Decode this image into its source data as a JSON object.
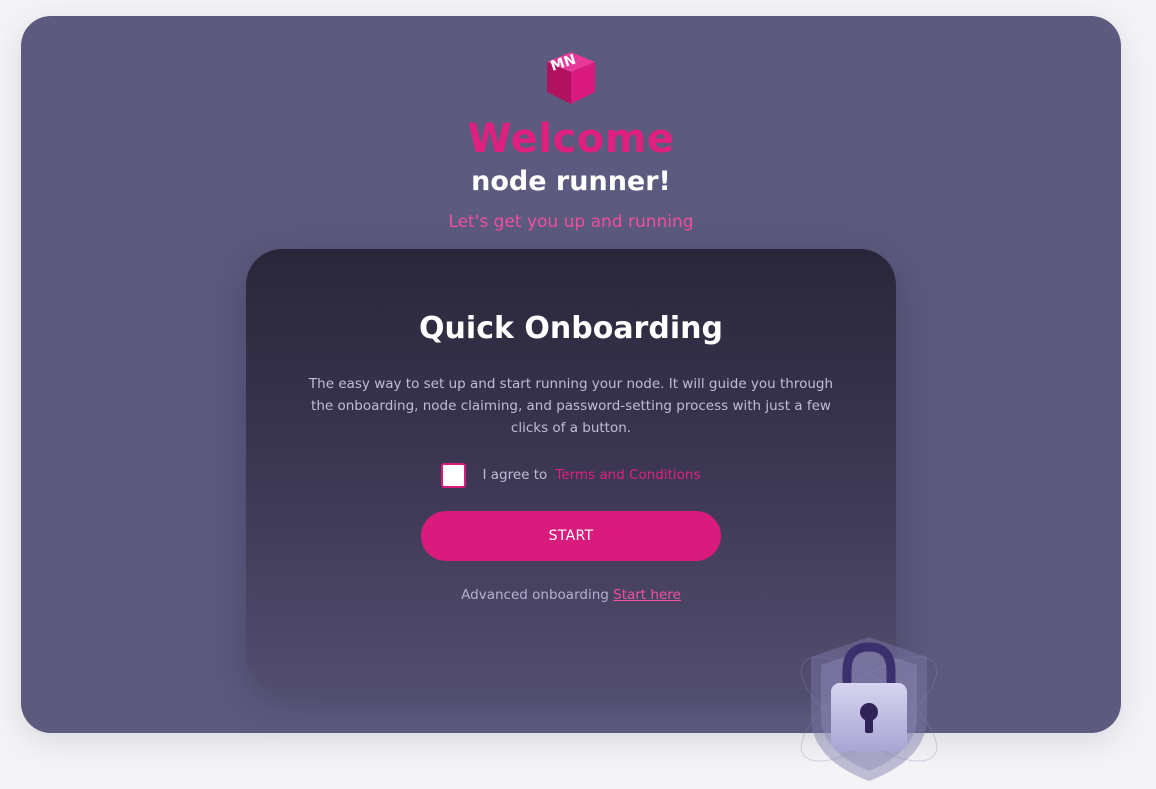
{
  "logo": {
    "text": "MN",
    "icon": "mn-cube-logo"
  },
  "header": {
    "welcome": "Welcome",
    "subtitle": "node runner!",
    "tagline": "Let's get you up and running"
  },
  "card": {
    "title": "Quick Onboarding",
    "description": "The easy way to set up and start running your node. It will guide you through the onboarding, node claiming, and password-setting process with just a few clicks of a button.",
    "agree_text": "I agree to",
    "terms_link": "Terms and Conditions",
    "start_label": "START",
    "advanced_text": "Advanced onboarding",
    "advanced_link": "Start here"
  },
  "decoration": {
    "icon": "lock-shield-icon"
  },
  "colors": {
    "accent": "#d81b7d",
    "accent_light": "#f0509e",
    "background": "#5c5a7e",
    "card_dark": "#2a2639"
  }
}
